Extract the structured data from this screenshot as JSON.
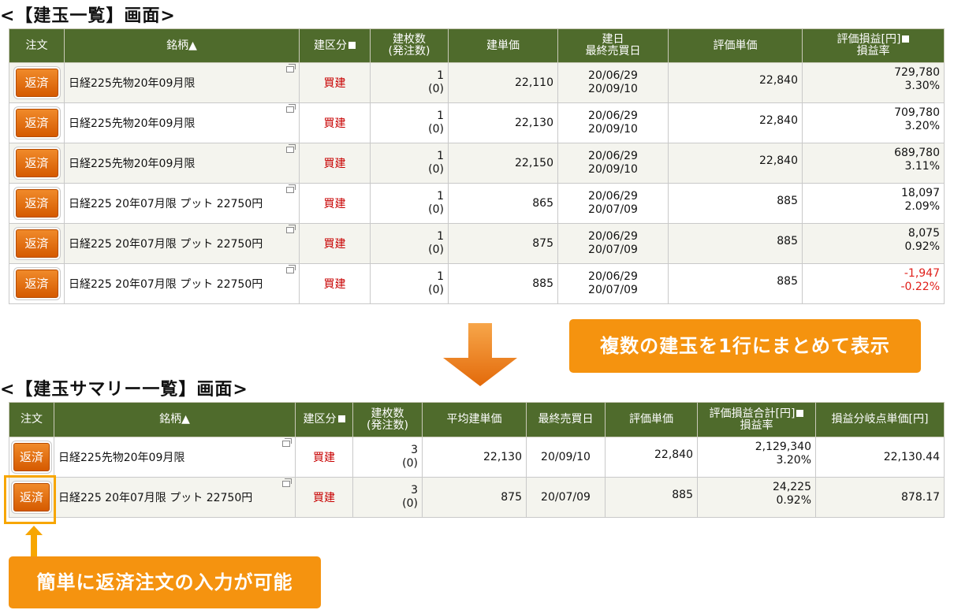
{
  "section1": {
    "title": "<【建玉一覧】画面>",
    "headers": {
      "order": "注文",
      "name": "銘柄▲",
      "type": "建区分",
      "qty1": "建枚数",
      "qty2": "(発注数)",
      "price": "建単価",
      "date1": "建日",
      "date2": "最終売買日",
      "eval_price": "評価単価",
      "pl1": "評価損益[円]",
      "pl2": "損益率"
    },
    "rows": [
      {
        "button": "返済",
        "name": "日経225先物20年09月限",
        "type": "買建",
        "qty": "1",
        "order_qty": "(0)",
        "price": "22,110",
        "date": "20/06/29",
        "last_date": "20/09/10",
        "eval_price": "22,840",
        "pl": "729,780",
        "rate": "3.30%",
        "negative": false
      },
      {
        "button": "返済",
        "name": "日経225先物20年09月限",
        "type": "買建",
        "qty": "1",
        "order_qty": "(0)",
        "price": "22,130",
        "date": "20/06/29",
        "last_date": "20/09/10",
        "eval_price": "22,840",
        "pl": "709,780",
        "rate": "3.20%",
        "negative": false
      },
      {
        "button": "返済",
        "name": "日経225先物20年09月限",
        "type": "買建",
        "qty": "1",
        "order_qty": "(0)",
        "price": "22,150",
        "date": "20/06/29",
        "last_date": "20/09/10",
        "eval_price": "22,840",
        "pl": "689,780",
        "rate": "3.11%",
        "negative": false
      },
      {
        "button": "返済",
        "name": "日経225 20年07月限 プット 22750円",
        "type": "買建",
        "qty": "1",
        "order_qty": "(0)",
        "price": "865",
        "date": "20/06/29",
        "last_date": "20/07/09",
        "eval_price": "885",
        "pl": "18,097",
        "rate": "2.09%",
        "negative": false
      },
      {
        "button": "返済",
        "name": "日経225 20年07月限 プット 22750円",
        "type": "買建",
        "qty": "1",
        "order_qty": "(0)",
        "price": "875",
        "date": "20/06/29",
        "last_date": "20/07/09",
        "eval_price": "885",
        "pl": "8,075",
        "rate": "0.92%",
        "negative": false
      },
      {
        "button": "返済",
        "name": "日経225 20年07月限 プット 22750円",
        "type": "買建",
        "qty": "1",
        "order_qty": "(0)",
        "price": "885",
        "date": "20/06/29",
        "last_date": "20/07/09",
        "eval_price": "885",
        "pl": "-1,947",
        "rate": "-0.22%",
        "negative": true
      }
    ]
  },
  "banner1": "複数の建玉を1行にまとめて表示",
  "section2": {
    "title": "<【建玉サマリー一覧】画面>",
    "headers": {
      "order": "注文",
      "name": "銘柄▲",
      "type": "建区分",
      "qty1": "建枚数",
      "qty2": "(発注数)",
      "avg_price": "平均建単価",
      "last_date": "最終売買日",
      "eval_price": "評価単価",
      "pl1": "評価損益合計[円]",
      "pl2": "損益率",
      "breakeven": "損益分岐点単価[円]"
    },
    "rows": [
      {
        "button": "返済",
        "name": "日経225先物20年09月限",
        "type": "買建",
        "qty": "3",
        "order_qty": "(0)",
        "avg_price": "22,130",
        "last_date": "20/09/10",
        "eval_price": "22,840",
        "pl": "2,129,340",
        "rate": "3.20%",
        "breakeven": "22,130.44"
      },
      {
        "button": "返済",
        "name": "日経225 20年07月限 プット 22750円",
        "type": "買建",
        "qty": "3",
        "order_qty": "(0)",
        "avg_price": "875",
        "last_date": "20/07/09",
        "eval_price": "885",
        "pl": "24,225",
        "rate": "0.92%",
        "breakeven": "878.17"
      }
    ]
  },
  "banner2": "簡単に返済注文の入力が可能",
  "colors": {
    "header_bg": "#4f6b2c",
    "button": "#e06a0c",
    "banner": "#f5930f",
    "buy": "#c80000",
    "negative": "#e0201b"
  }
}
